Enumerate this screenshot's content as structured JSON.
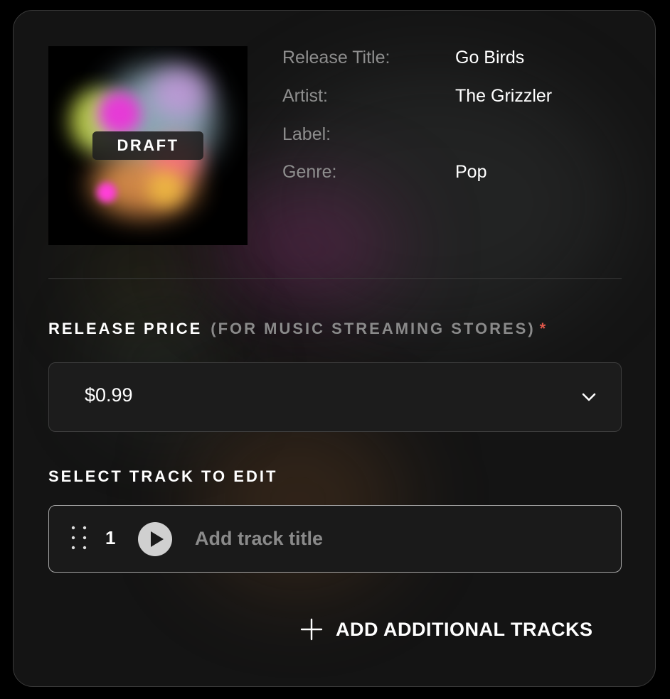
{
  "artwork": {
    "badge": "DRAFT",
    "colors": [
      "#e63ad6",
      "#c8d84a",
      "#b8e0f0",
      "#f0a040",
      "#ff6a8a",
      "#e040e0"
    ]
  },
  "release_info": {
    "title_label": "Release Title:",
    "title_value": "Go Birds",
    "artist_label": "Artist:",
    "artist_value": "The Grizzler",
    "label_label": "Label:",
    "label_value": "",
    "genre_label": "Genre:",
    "genre_value": "Pop"
  },
  "release_price": {
    "heading": "RELEASE PRICE",
    "subheading": "(FOR MUSIC STREAMING STORES)",
    "required_marker": "*",
    "selected": "$0.99",
    "icon": "chevron-down-icon"
  },
  "tracks": {
    "heading": "SELECT TRACK TO EDIT",
    "items": [
      {
        "number": "1",
        "title": "",
        "title_placeholder": "Add track title"
      }
    ],
    "add_button_label": "ADD ADDITIONAL TRACKS"
  },
  "colors": {
    "background": "#000000",
    "card": "#141414",
    "text_primary": "#ffffff",
    "text_muted": "#8e8e8e",
    "required": "#e0574a",
    "track_border": "#a8a8a8"
  }
}
